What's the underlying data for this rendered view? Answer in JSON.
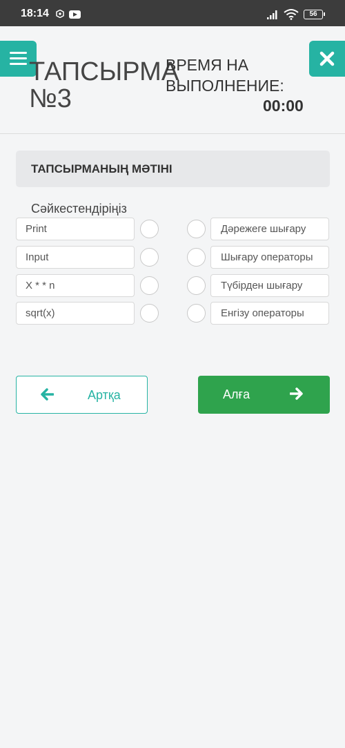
{
  "status_bar": {
    "time": "18:14",
    "battery": "56"
  },
  "header": {
    "title_line1": "ТАПСЫРМА",
    "title_line2": "№3",
    "timer_label_line1": "ВРЕМЯ НА",
    "timer_label_line2": "ВЫПОЛНЕНИЕ:",
    "timer_value": "00:00"
  },
  "task": {
    "title": "ТАПСЫРМАНЫҢ МӘТІНІ",
    "instruction": "Сәйкестендіріңіз",
    "left_items": [
      "Print",
      "Input",
      "X * * n",
      "sqrt(x)"
    ],
    "right_items": [
      "Дәрежеге шығару",
      "Шығару операторы",
      "Түбірден шығару",
      "Енгізу операторы"
    ]
  },
  "nav": {
    "back_label": "Артқа",
    "next_label": "Алға"
  },
  "colors": {
    "accent": "#26b3a3",
    "next": "#2fa34d",
    "status_bar": "#3c3c3c"
  }
}
